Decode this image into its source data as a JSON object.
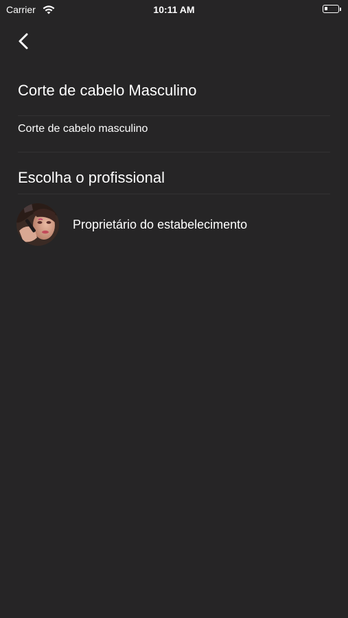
{
  "status_bar": {
    "carrier": "Carrier",
    "time": "10:11 AM",
    "battery_level": 0.25,
    "wifi_icon": "wifi-icon",
    "battery_icon": "battery-icon"
  },
  "nav": {
    "back_icon": "chevron-left-icon"
  },
  "service": {
    "title": "Corte de cabelo Masculino",
    "description": "Corte de cabelo masculino"
  },
  "professionals": {
    "section_title": "Escolha o profissional",
    "items": [
      {
        "name": "Proprietário do estabelecimento",
        "avatar_icon": "avatar"
      }
    ]
  },
  "colors": {
    "background": "#262526",
    "text": "#ffffff",
    "divider": "#333233"
  }
}
